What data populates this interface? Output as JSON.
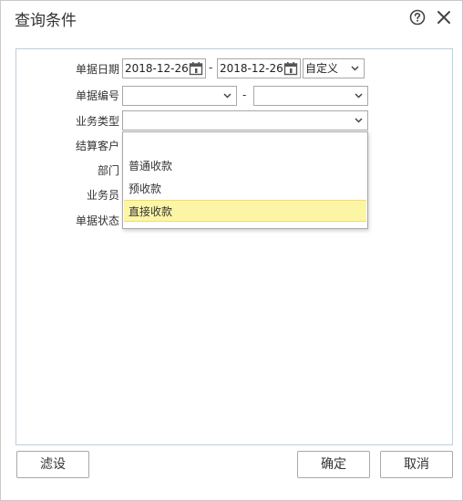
{
  "dialog": {
    "title": "查询条件",
    "help_icon": "help-circle-icon",
    "close_icon": "close-icon"
  },
  "form": {
    "date_label": "单据日期",
    "date_from": "2018-12-26",
    "date_sep": "-",
    "date_to": "2018-12-26",
    "date_range_value": "自定义",
    "doc_no_label": "单据编号",
    "doc_no_sep": "-",
    "doc_no_from": "",
    "doc_no_to": "",
    "biz_type_label": "业务类型",
    "biz_type_value": "",
    "customer_label": "结算客户",
    "dept_label": "部门",
    "salesman_label": "业务员",
    "status_label": "单据状态"
  },
  "biz_type_options": [
    {
      "label": ""
    },
    {
      "label": "普通收款"
    },
    {
      "label": "预收款"
    },
    {
      "label": "直接收款",
      "highlighted": true
    }
  ],
  "footer": {
    "filter_label": "滤设",
    "ok_label": "确定",
    "cancel_label": "取消"
  },
  "colors": {
    "panel_border": "#b8cfe0",
    "highlight_bg": "#fdf5a6",
    "highlight_border": "#f2dc6a"
  }
}
